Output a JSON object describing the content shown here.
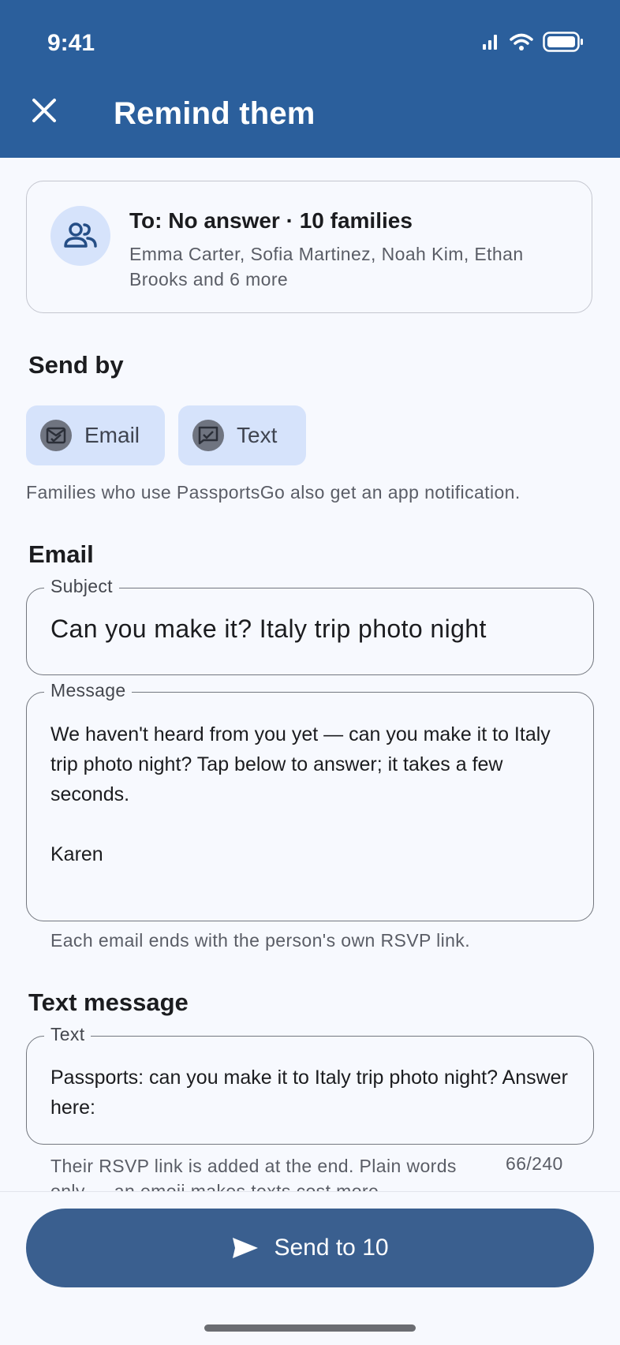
{
  "status_bar": {
    "time": "9:41"
  },
  "app_bar": {
    "title": "Remind them"
  },
  "recipients": {
    "title": "To: No answer · 10 families",
    "names": "Emma Carter, Sofia Martinez, Noah Kim, Ethan Brooks and 6 more"
  },
  "send_by": {
    "heading": "Send by",
    "options": [
      {
        "label": "Email",
        "icon": "email-check-icon",
        "selected": true
      },
      {
        "label": "Text",
        "icon": "text-check-icon",
        "selected": true
      }
    ],
    "helper": "Families who use PassportsGo also get an app notification."
  },
  "email": {
    "heading": "Email",
    "subject_label": "Subject",
    "subject_value": "Can you make it? Italy trip photo night",
    "message_label": "Message",
    "message_value": "We haven't heard from you yet — can you make it to Italy trip photo night? Tap below to answer; it takes a few seconds.\n\nKaren",
    "helper": "Each email ends with the person's own RSVP link."
  },
  "text_message": {
    "heading": "Text message",
    "field_label": "Text",
    "field_value": "Passports: can you make it to Italy trip photo night? Answer here:",
    "helper": "Their RSVP link is added at the end. Plain words only — an emoji makes texts cost more.",
    "counter": "66/240"
  },
  "send_button": {
    "label": "Send to 10",
    "icon": "send-icon"
  },
  "colors": {
    "app_bar": "#2b5f9c",
    "chip": "#d6e3fb",
    "send_button": "#3a5f8f",
    "background": "#f7f9fe"
  }
}
